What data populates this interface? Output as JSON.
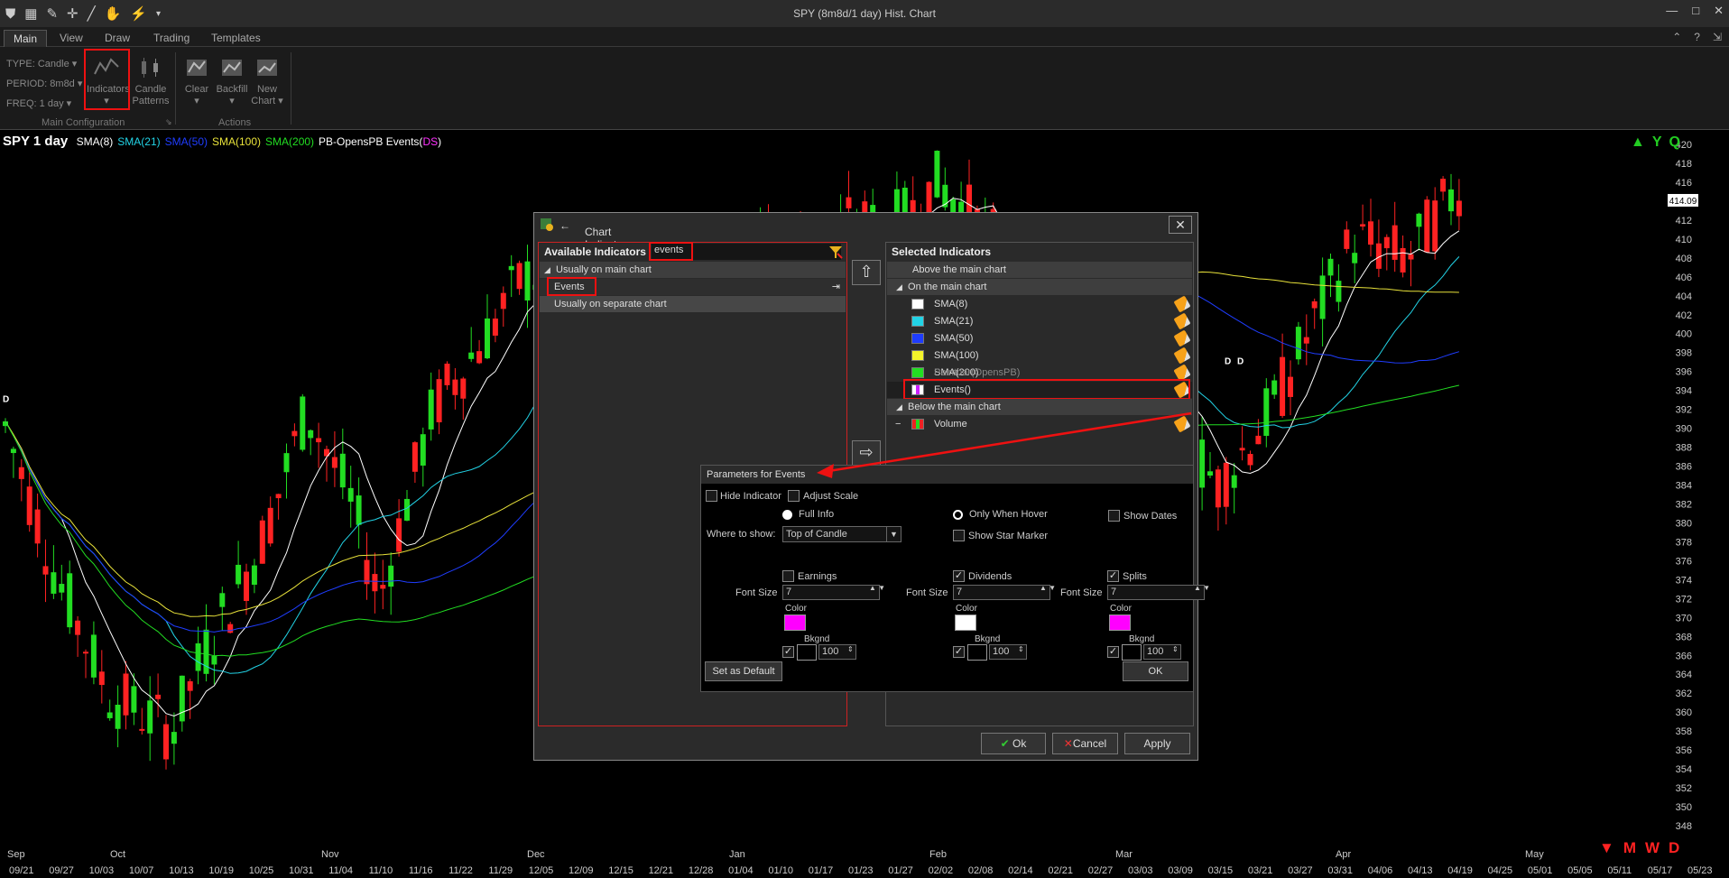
{
  "window": {
    "title": "SPY (8m8d/1 day) Hist. Chart"
  },
  "ribbon": {
    "tabs": [
      "Main",
      "View",
      "Draw",
      "Trading",
      "Templates"
    ],
    "type_label": "TYPE: Candle",
    "period_label": "PERIOD: 8m8d",
    "freq_label": "FREQ: 1 day",
    "indicators_label": "Indicators",
    "candle_label_1": "Candle",
    "candle_label_2": "Patterns",
    "clear_label": "Clear",
    "backfill_label": "Backfill",
    "new_chart_1": "New",
    "new_chart_2": "Chart",
    "group_main": "Main Configuration",
    "group_actions": "Actions"
  },
  "chart": {
    "symbol": "SPY 1 day",
    "legend": [
      {
        "text": "SMA(8)",
        "color": "#ffffff"
      },
      {
        "text": "SMA(21)",
        "color": "#22d3e6"
      },
      {
        "text": "SMA(50)",
        "color": "#1f3dff"
      },
      {
        "text": "SMA(100)",
        "color": "#e8e23a"
      },
      {
        "text": "SMA(200)",
        "color": "#22dd22"
      },
      {
        "text": "PB-OpensPB Events(",
        "color": "#ffffff"
      },
      {
        "text": "D",
        "color": "#ff33ff"
      },
      {
        "text": "S",
        "color": "#ff33ff"
      },
      {
        "text": ")",
        "color": "#ffffff"
      }
    ],
    "price_labels": [
      "420",
      "418",
      "416",
      "414",
      "412",
      "410",
      "408",
      "406",
      "404",
      "402",
      "400",
      "398",
      "396",
      "394",
      "392",
      "390",
      "388",
      "386",
      "384",
      "382",
      "380",
      "378",
      "376",
      "374",
      "372",
      "370",
      "368",
      "366",
      "364",
      "362",
      "360",
      "358",
      "356",
      "354",
      "352",
      "350",
      "348"
    ],
    "last_price": "414.09",
    "month_labels": [
      "Sep",
      "Oct",
      "Nov",
      "Dec",
      "Jan",
      "Feb",
      "Mar",
      "Apr",
      "May"
    ],
    "date_labels": [
      "09/21",
      "09/27",
      "10/03",
      "10/07",
      "10/13",
      "10/19",
      "10/25",
      "10/31",
      "11/04",
      "11/10",
      "11/16",
      "11/22",
      "11/29",
      "12/05",
      "12/09",
      "12/15",
      "12/21",
      "12/28",
      "01/04",
      "01/10",
      "01/17",
      "01/23",
      "01/27",
      "02/02",
      "02/08",
      "02/14",
      "02/21",
      "02/27",
      "03/03",
      "03/09",
      "03/15",
      "03/21",
      "03/27",
      "03/31",
      "04/06",
      "04/13",
      "04/19",
      "04/25",
      "05/01",
      "05/05",
      "05/11",
      "05/17",
      "05/23"
    ],
    "top_right_glyphs": [
      "Y",
      "Q"
    ],
    "bottom_right_glyphs": [
      "M",
      "W",
      "D"
    ],
    "event_marker": "D"
  },
  "dialog": {
    "title": "Chart Indicator Selection",
    "available_header": "Available Indicators",
    "search_value": "events",
    "group_main": "Usually on main chart",
    "item_events": "Events",
    "group_separate": "Usually on separate chart",
    "selected_header": "Selected Indicators",
    "above_main": "Above the main chart",
    "on_main": "On the main chart",
    "selected_items": [
      {
        "name": "SMA(8)",
        "color": "#ffffff"
      },
      {
        "name": "SMA(21)",
        "color": "#22d3e6"
      },
      {
        "name": "SMA(50)",
        "color": "#1f3dff"
      },
      {
        "name": "SMA(100)",
        "color": "#f4f42a"
      },
      {
        "name": "SMA(200)",
        "color": "#22dd22"
      }
    ],
    "paintbar": "Paintbar(OpensPB)",
    "events_item": "Events()",
    "below_main": "Below the main chart",
    "volume_item": "Volume",
    "ok_label": "Ok",
    "cancel_label": "Cancel",
    "apply_label": "Apply"
  },
  "params": {
    "header": "Parameters for Events",
    "hide_indicator": "Hide Indicator",
    "adjust_scale": "Adjust Scale",
    "full_info": "Full Info",
    "only_when_hover": "Only When Hover",
    "show_dates": "Show Dates",
    "where_to_show_label": "Where to show:",
    "where_to_show_value": "Top of Candle",
    "show_star_marker": "Show Star Marker",
    "earnings": "Earnings",
    "dividends": "Dividends",
    "splits": "Splits",
    "font_size_label": "Font Size",
    "font_size_value": "7",
    "color_label": "Color",
    "bkgnd_label": "Bkgnd",
    "bkgnd_value": "100",
    "colors": {
      "earnings": "#ff00ff",
      "dividends": "#ffffff",
      "splits": "#ff00ff"
    },
    "set_default": "Set as Default",
    "ok": "OK"
  }
}
